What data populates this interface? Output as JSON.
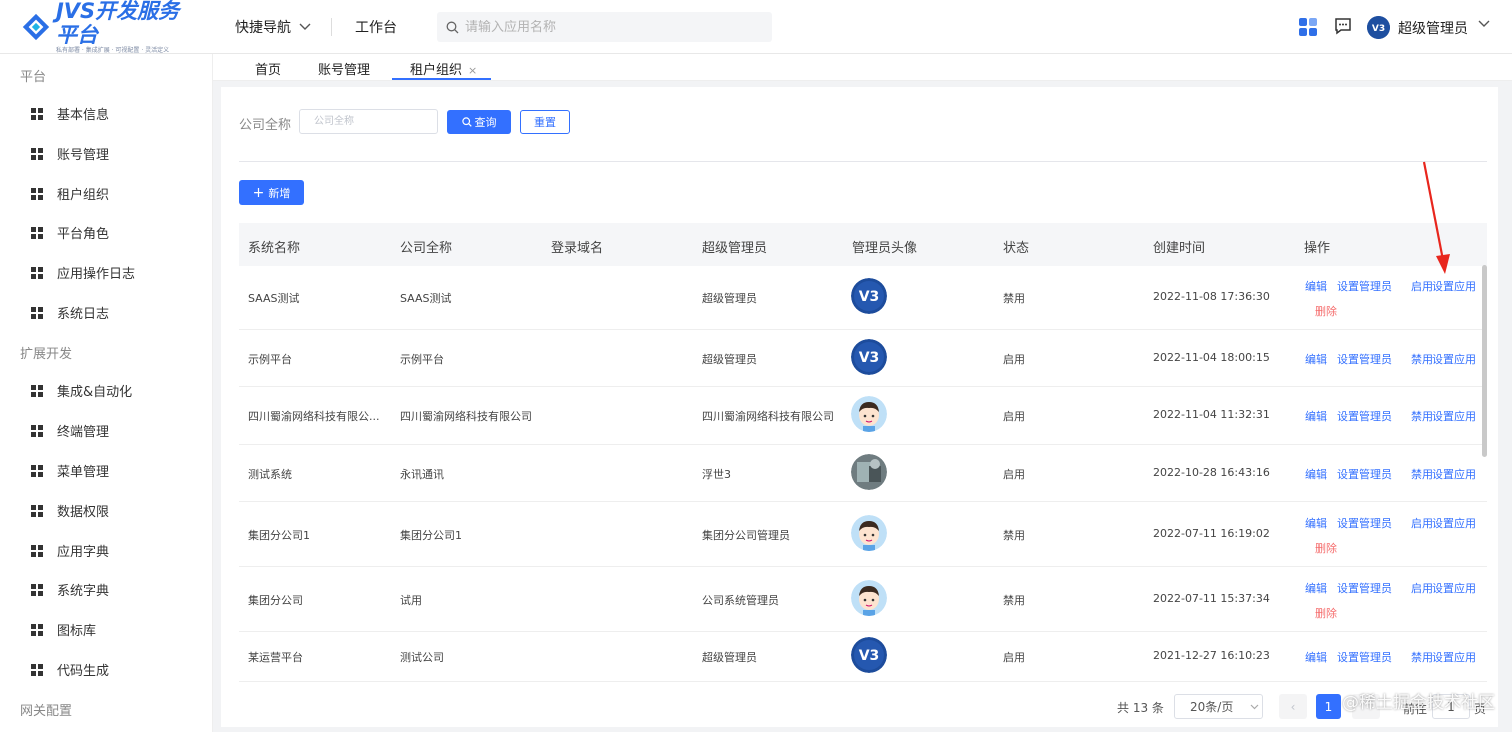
{
  "app": {
    "logo_title": "JVS开发服务平台",
    "logo_sub": "私有部署 · 集成扩展 · 可视配置 · 灵活定义"
  },
  "topbar": {
    "quick_nav": "快捷导航",
    "workbench": "工作台",
    "search_placeholder": "请输入应用名称",
    "user_name": "超级管理员",
    "icons": [
      "apps-icon",
      "message-icon",
      "user-avatar-icon",
      "chevron-down-icon"
    ]
  },
  "sidebar": {
    "groups": [
      {
        "label": "平台",
        "items": [
          "基本信息",
          "账号管理",
          "租户组织",
          "平台角色",
          "应用操作日志",
          "系统日志"
        ]
      },
      {
        "label": "扩展开发",
        "items": [
          "集成&自动化",
          "终端管理",
          "菜单管理",
          "数据权限",
          "应用字典",
          "系统字典",
          "图标库",
          "代码生成"
        ]
      },
      {
        "label": "网关配置",
        "items": []
      }
    ]
  },
  "tabs": [
    {
      "label": "首页",
      "active": false
    },
    {
      "label": "账号管理",
      "active": false
    },
    {
      "label": "租户组织",
      "active": true,
      "closable": true
    }
  ],
  "filter": {
    "label": "公司全称",
    "placeholder": "公司全称",
    "query_label": "查询",
    "reset_label": "重置"
  },
  "toolbar": {
    "add_label": "新增"
  },
  "table": {
    "columns": [
      "系统名称",
      "公司全称",
      "登录域名",
      "超级管理员",
      "管理员头像",
      "状态",
      "创建时间",
      "操作"
    ],
    "rows": [
      {
        "system": "SAAS测试",
        "company": "SAAS测试",
        "domain": "",
        "admin": "超级管理员",
        "avatar": "v3-logo",
        "status": "禁用",
        "created": "2022-11-08 17:36:30",
        "toggle": "启用",
        "deletable": true
      },
      {
        "system": "示例平台",
        "company": "示例平台",
        "domain": "",
        "admin": "超级管理员",
        "avatar": "v3-logo",
        "status": "启用",
        "created": "2022-11-04 18:00:15",
        "toggle": "禁用",
        "deletable": false
      },
      {
        "system": "四川蜀渝网络科技有限公...",
        "company": "四川蜀渝网络科技有限公司",
        "domain": "",
        "admin": "四川蜀渝网络科技有限公司",
        "avatar": "cartoon-boy",
        "status": "启用",
        "created": "2022-11-04 11:32:31",
        "toggle": "禁用",
        "deletable": false
      },
      {
        "system": "测试系统",
        "company": "永讯通讯",
        "domain": "",
        "admin": "浮世3",
        "avatar": "photo",
        "status": "启用",
        "created": "2022-10-28 16:43:16",
        "toggle": "禁用",
        "deletable": false
      },
      {
        "system": "集团分公司1",
        "company": "集团分公司1",
        "domain": "",
        "admin": "集团分公司管理员",
        "avatar": "cartoon-boy",
        "status": "禁用",
        "created": "2022-07-11 16:19:02",
        "toggle": "启用",
        "deletable": true
      },
      {
        "system": "集团分公司",
        "company": "试用",
        "domain": "",
        "admin": "公司系统管理员",
        "avatar": "cartoon-boy",
        "status": "禁用",
        "created": "2022-07-11 15:37:34",
        "toggle": "启用",
        "deletable": true
      },
      {
        "system": "某运营平台",
        "company": "测试公司",
        "domain": "",
        "admin": "超级管理员",
        "avatar": "v3-logo",
        "status": "启用",
        "created": "2021-12-27 16:10:23",
        "toggle": "禁用",
        "deletable": false
      }
    ],
    "op_edit": "编辑",
    "op_set_admin": "设置管理员",
    "op_set_app": "设置应用",
    "op_delete": "删除"
  },
  "pagination": {
    "total": "共 13 条",
    "page_size": "20条/页",
    "current_page": "1",
    "goto": "前往",
    "jump_value": "1",
    "page_suffix": "页"
  },
  "watermark": "@稀土掘金技术社区",
  "colors": {
    "primary": "#3370ff",
    "danger": "#f56c6c",
    "annotation_arrow": "#e8261d"
  }
}
